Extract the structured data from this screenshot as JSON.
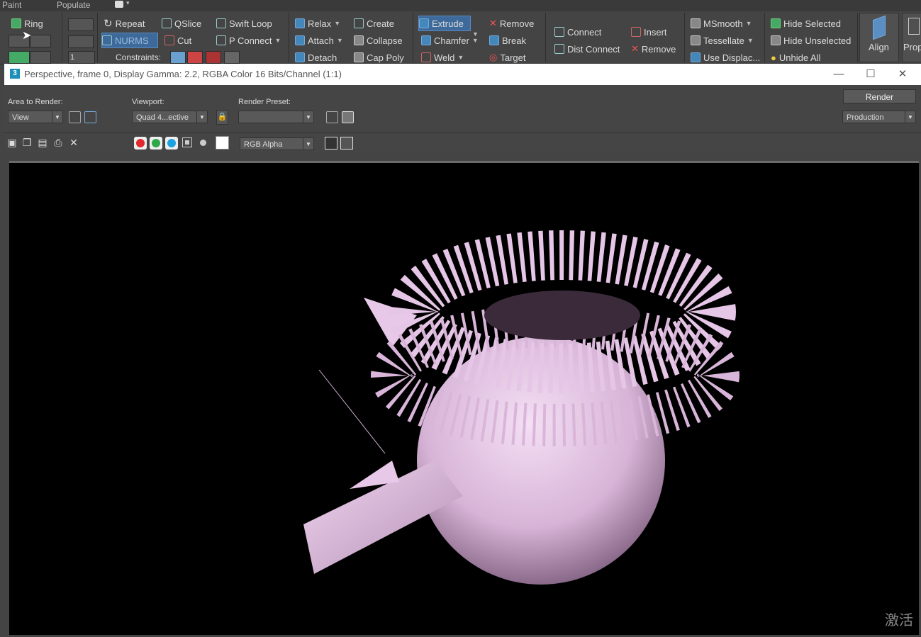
{
  "topbar": {
    "tabs": [
      "Paint",
      "Populate"
    ]
  },
  "ribbon": {
    "ring": "Ring",
    "repeat": "Repeat",
    "qslice": "QSlice",
    "swift_loop": "Swift Loop",
    "nurms": "NURMS",
    "cut": "Cut",
    "p_connect": "P Connect",
    "constraints": "Constraints:",
    "spinner_value": "1",
    "relax": "Relax",
    "attach": "Attach",
    "detach": "Detach",
    "create": "Create",
    "collapse": "Collapse",
    "cap_poly": "Cap Poly",
    "extrude": "Extrude",
    "chamfer": "Chamfer",
    "weld": "Weld",
    "remove1": "Remove",
    "break": "Break",
    "target": "Target",
    "connect": "Connect",
    "dist_connect": "Dist Connect",
    "insert": "Insert",
    "remove2": "Remove",
    "msmooth": "MSmooth",
    "tessellate": "Tessellate",
    "use_displace": "Use Displac...",
    "hide_selected": "Hide Selected",
    "hide_unselected": "Hide Unselected",
    "unhide_all": "Unhide All",
    "align": "Align",
    "prop": "Prop"
  },
  "window": {
    "title": "Perspective, frame 0, Display Gamma: 2.2, RGBA Color 16 Bits/Channel (1:1)",
    "area_label": "Area to Render:",
    "area_value": "View",
    "viewport_label": "Viewport:",
    "viewport_value": "Quad 4...ective",
    "preset_label": "Render Preset:",
    "preset_value": "",
    "render_button": "Render",
    "render_mode": "Production",
    "channel": "RGB Alpha"
  },
  "watermark": "激活",
  "colors": {
    "accent": "#3d6a9a",
    "red": "#e0282e",
    "green": "#2fa84a",
    "blue": "#1aa3e0",
    "render_bg": "#000000",
    "mesh": "#e8c6e8"
  }
}
